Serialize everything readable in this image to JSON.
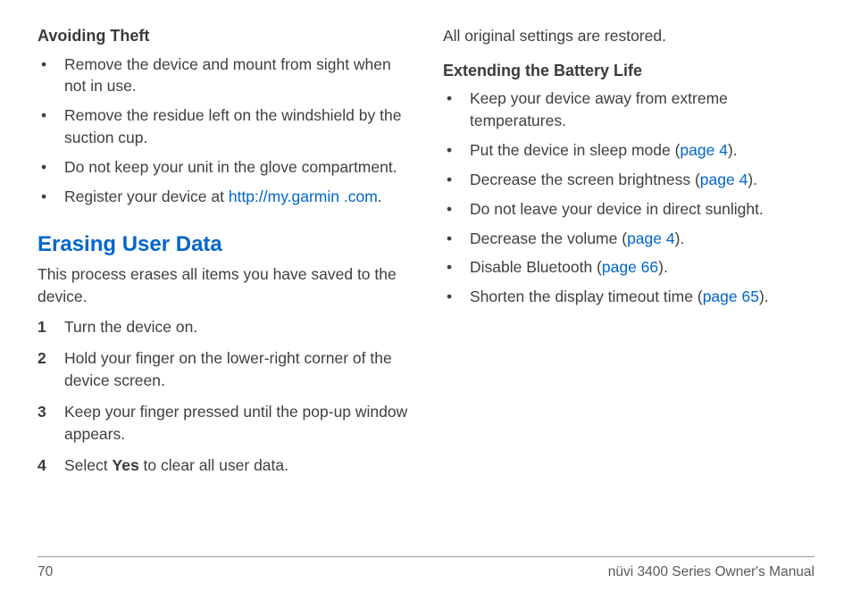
{
  "left": {
    "heading1": "Avoiding Theft",
    "bullets1": [
      {
        "pre": "Remove the device and mount from sight when not in use."
      },
      {
        "pre": "Remove the residue left on the windshield by the suction cup."
      },
      {
        "pre": "Do not keep your unit in the glove compartment."
      },
      {
        "pre": "Register your device at ",
        "link": "http://my.garmin .com",
        "post": "."
      }
    ],
    "heading2": "Erasing User Data",
    "intro": "This process erases all items you have saved to the device.",
    "steps": [
      {
        "n": "1",
        "text": "Turn the device on."
      },
      {
        "n": "2",
        "text": "Hold your finger on the lower-right corner of the device screen."
      },
      {
        "n": "3",
        "text": "Keep your finger pressed until the pop-up window appears."
      },
      {
        "n": "4",
        "pre": "Select ",
        "bold": "Yes",
        "post": " to clear all user data."
      }
    ]
  },
  "right": {
    "restore": "All original settings are restored.",
    "heading": "Extending the Battery Life",
    "bullets": [
      {
        "pre": "Keep your device away from extreme temperatures."
      },
      {
        "pre": "Put the device in sleep mode (",
        "link": "page 4",
        "post": ")."
      },
      {
        "pre": "Decrease the screen brightness (",
        "link": "page 4",
        "post": ")."
      },
      {
        "pre": "Do not leave your device in direct sunlight."
      },
      {
        "pre": "Decrease the volume (",
        "link": "page 4",
        "post": ")."
      },
      {
        "pre": "Disable Bluetooth (",
        "link": "page 66",
        "post": ")."
      },
      {
        "pre": "Shorten the display timeout time (",
        "link": "page 65",
        "post": ")."
      }
    ]
  },
  "footer": {
    "page": "70",
    "title": "nüvi 3400 Series Owner's Manual"
  }
}
